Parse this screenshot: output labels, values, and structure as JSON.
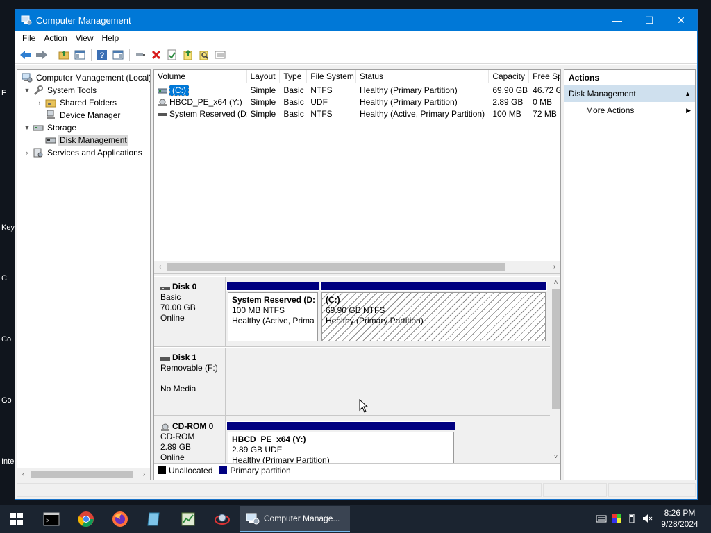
{
  "window": {
    "title": "Computer Management",
    "minimize": "—",
    "maximize": "☐",
    "close": "✕"
  },
  "menu": [
    "File",
    "Action",
    "View",
    "Help"
  ],
  "tree": {
    "root": "Computer Management (Local)",
    "system_tools": "System Tools",
    "shared_folders": "Shared Folders",
    "device_manager": "Device Manager",
    "storage": "Storage",
    "disk_management": "Disk Management",
    "services": "Services and Applications"
  },
  "volumes": {
    "columns": [
      "Volume",
      "Layout",
      "Type",
      "File System",
      "Status",
      "Capacity",
      "Free Sp"
    ],
    "rows": [
      {
        "volume": "(C:)",
        "layout": "Simple",
        "type": "Basic",
        "fs": "NTFS",
        "status": "Healthy (Primary Partition)",
        "capacity": "69.90 GB",
        "free": "46.72 G"
      },
      {
        "volume": "HBCD_PE_x64 (Y:)",
        "layout": "Simple",
        "type": "Basic",
        "fs": "UDF",
        "status": "Healthy (Primary Partition)",
        "capacity": "2.89 GB",
        "free": "0 MB"
      },
      {
        "volume": "System Reserved (D:)",
        "layout": "Simple",
        "type": "Basic",
        "fs": "NTFS",
        "status": "Healthy (Active, Primary Partition)",
        "capacity": "100 MB",
        "free": "72 MB"
      }
    ]
  },
  "disks": {
    "disk0": {
      "name": "Disk 0",
      "type": "Basic",
      "size": "70.00 GB",
      "state": "Online"
    },
    "disk0_p1": {
      "name": "System Reserved  (D:",
      "size": "100 MB NTFS",
      "status": "Healthy (Active, Prima"
    },
    "disk0_p2": {
      "name": "(C:)",
      "size": "69.90 GB NTFS",
      "status": "Healthy (Primary Partition)"
    },
    "disk1": {
      "name": "Disk 1",
      "type": "Removable (F:)",
      "state": "No Media"
    },
    "cdrom0": {
      "name": "CD-ROM 0",
      "type": "CD-ROM",
      "size": "2.89 GB",
      "state": "Online"
    },
    "cdrom0_p1": {
      "name": "HBCD_PE_x64  (Y:)",
      "size": "2.89 GB UDF",
      "status": "Healthy (Primary Partition)"
    }
  },
  "legend": {
    "unallocated": "Unallocated",
    "primary": "Primary partition"
  },
  "colors": {
    "primary_band": "#000080",
    "unallocated": "#000000",
    "accent": "#0078d7"
  },
  "actions": {
    "title": "Actions",
    "section": "Disk Management",
    "more": "More Actions"
  },
  "desktop_labels": [
    "F",
    "Key",
    "C",
    "Co",
    "Go",
    "Inte"
  ],
  "taskbar": {
    "active_label": "Computer Manage...",
    "time": "8:26 PM",
    "date": "9/28/2024"
  }
}
